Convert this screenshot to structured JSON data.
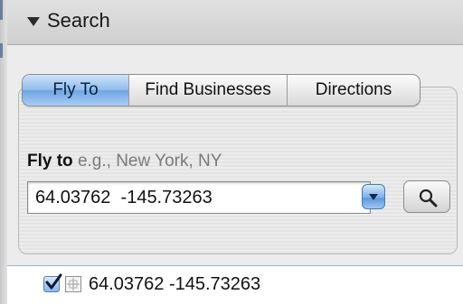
{
  "panel": {
    "header": {
      "title": "Search",
      "icons": {
        "collapse": "disclosure-triangle-down-icon"
      }
    },
    "tabs": [
      {
        "label": "Fly To",
        "active": true
      },
      {
        "label": "Find Businesses",
        "active": false
      },
      {
        "label": "Directions",
        "active": false
      }
    ],
    "fly_to": {
      "label": "Fly to",
      "hint": "e.g., New York, NY",
      "value": "64.03762  -145.73263",
      "dropdown_icon": "chevron-down-icon",
      "search_icon": "magnifier-icon"
    },
    "results": [
      {
        "checked": true,
        "icon": "placemark-crosshair-icon",
        "label": "64.03762 -145.73263"
      }
    ]
  },
  "colors": {
    "accent": "#7aaeea",
    "header_bg": "#d6d6d6",
    "body_bg": "#ececec"
  }
}
